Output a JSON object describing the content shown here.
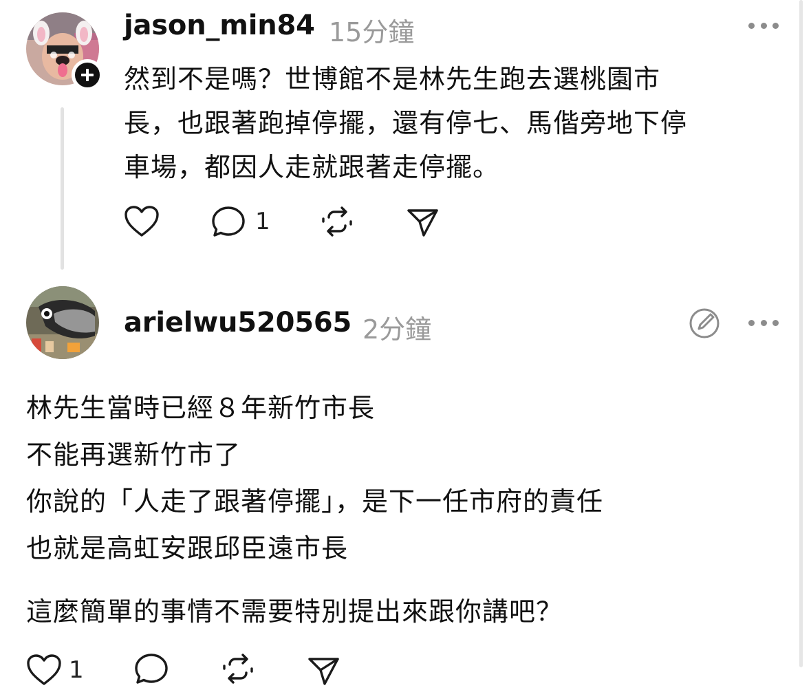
{
  "post1": {
    "username": "jason_min84",
    "timestamp": "15分鐘",
    "avatar_icon": "dog-filter-avatar",
    "follow_icon": "plus-icon",
    "lines": [
      "然到不是嗎？世博館不是林先生跑去選桃園市",
      "長，也跟著跑掉停擺，還有停七、馬偕旁地下停",
      "車場，都因人走就跟著走停擺。"
    ],
    "actions": {
      "reply_count": "1"
    }
  },
  "post2": {
    "username": "arielwu520565",
    "timestamp": "2分鐘",
    "avatar_icon": "fish-avatar",
    "lines": [
      "林先生當時已經８年新竹市長",
      "不能再選新竹市了",
      "你說的「人走了跟著停擺」，是下一任市府的責任",
      "也就是高虹安跟邱臣遠市長",
      "這麼簡單的事情不需要特別提出來跟你講吧？"
    ],
    "actions": {
      "like_count": "1"
    }
  }
}
